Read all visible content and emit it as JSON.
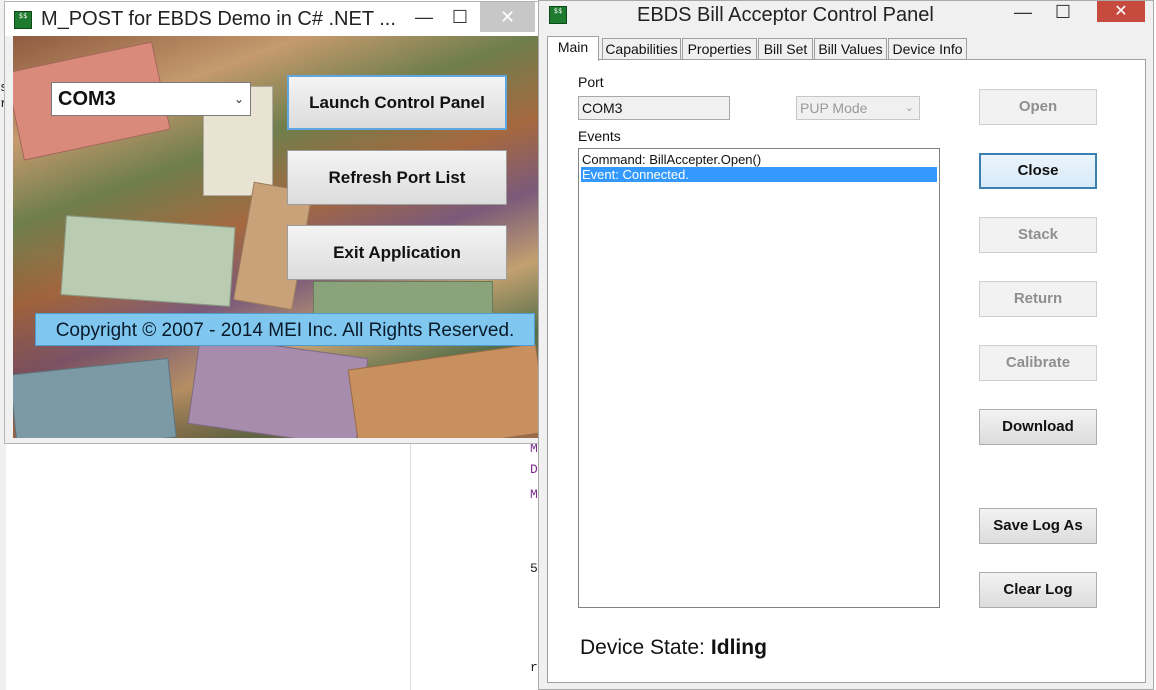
{
  "background": {
    "chars": [
      "s",
      "r",
      "M",
      "D",
      "M",
      "5",
      "r"
    ]
  },
  "left_window": {
    "title": "M_POST for EBDS Demo in C# .NET ...",
    "controls": {
      "minimize": "—",
      "maximize": "☐",
      "close": "✕"
    },
    "port_select": {
      "value": "COM3"
    },
    "buttons": {
      "launch": "Launch Control Panel",
      "refresh": "Refresh Port List",
      "exit": "Exit Application"
    },
    "copyright": "Copyright © 2007 - 2014 MEI Inc. All Rights Reserved."
  },
  "right_window": {
    "title": "EBDS Bill Acceptor Control Panel",
    "controls": {
      "minimize": "—",
      "maximize": "☐",
      "close": "✕"
    },
    "tabs": [
      "Main",
      "Capabilities",
      "Properties",
      "Bill Set",
      "Bill Values",
      "Device Info"
    ],
    "active_tab": "Main",
    "port_label": "Port",
    "port_value": "COM3",
    "pup_mode": "PUP Mode",
    "events_label": "Events",
    "events": [
      "Command: BillAccepter.Open()",
      "Event: Connected."
    ],
    "selected_event_index": 1,
    "buttons": {
      "open": "Open",
      "close": "Close",
      "stack": "Stack",
      "return": "Return",
      "calibrate": "Calibrate",
      "download": "Download",
      "save_log": "Save Log As",
      "clear_log": "Clear Log"
    },
    "device_state_label": "Device State:",
    "device_state_value": "Idling"
  },
  "colors": {
    "selection": "#3399ff",
    "copyright_bg": "#7fc7ee",
    "close_red": "#c74a3f"
  }
}
